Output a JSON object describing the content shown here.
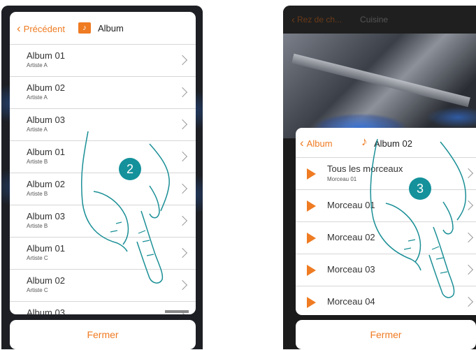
{
  "left_screen": {
    "header": {
      "back_label": "Précédent",
      "title": "Album",
      "folder_icon": "music-folder-icon"
    },
    "items": [
      {
        "title": "Album 01",
        "artist": "Artiste A"
      },
      {
        "title": "Album 02",
        "artist": "Artiste A"
      },
      {
        "title": "Album 03",
        "artist": "Artiste A"
      },
      {
        "title": "Album 01",
        "artist": "Artiste B"
      },
      {
        "title": "Album 02",
        "artist": "Artiste B"
      },
      {
        "title": "Album 03",
        "artist": "Artiste B"
      },
      {
        "title": "Album 01",
        "artist": "Artiste C"
      },
      {
        "title": "Album 02",
        "artist": "Artiste C"
      },
      {
        "title": "Album 03",
        "artist": ""
      }
    ],
    "close_label": "Fermer",
    "step": "2"
  },
  "right_screen": {
    "topbar": {
      "back_label": "Rez de ch...",
      "room": "Cuisine"
    },
    "header": {
      "back_label": "Album",
      "title": "Album 02",
      "note_icon": "music-note-icon"
    },
    "tracks": [
      {
        "title": "Tous les morceaux",
        "subtitle": "Morceau 01"
      },
      {
        "title": "Morceau 01",
        "subtitle": ""
      },
      {
        "title": "Morceau 02",
        "subtitle": ""
      },
      {
        "title": "Morceau 03",
        "subtitle": ""
      },
      {
        "title": "Morceau 04",
        "subtitle": ""
      }
    ],
    "close_label": "Fermer",
    "step": "3"
  },
  "colors": {
    "accent": "#ef7b22",
    "badge": "#14919b",
    "hand_stroke": "#1a8f96"
  }
}
